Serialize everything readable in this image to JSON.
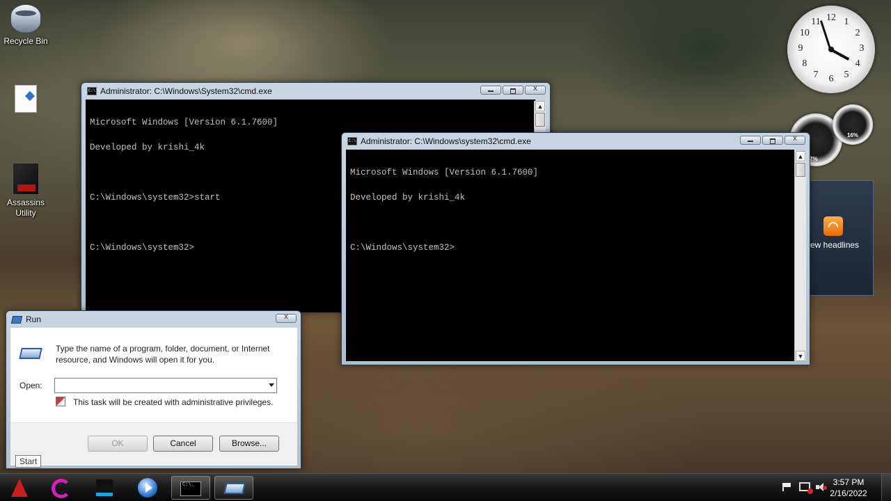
{
  "desktop": {
    "icons": [
      {
        "label": "Recycle Bin"
      },
      {
        "label": ""
      },
      {
        "label_line1": "Assassins",
        "label_line2": "Utility"
      }
    ]
  },
  "gadgets": {
    "clock": {
      "hour": 3,
      "minute": 57,
      "numerals": [
        "12",
        "1",
        "2",
        "3",
        "4",
        "5",
        "6",
        "7",
        "8",
        "9",
        "10",
        "11"
      ]
    },
    "cpu_meter": {
      "cpu_label": "7%",
      "memory_label": "16%"
    },
    "feed": {
      "headline_text": "ew headlines"
    }
  },
  "cmd_back": {
    "title": "Administrator: C:\\Windows\\System32\\cmd.exe",
    "lines": [
      "Microsoft Windows [Version 6.1.7600]",
      "Developed by krishi_4k",
      "",
      "C:\\Windows\\system32>start",
      "",
      "C:\\Windows\\system32>"
    ]
  },
  "cmd_front": {
    "title": "Administrator: C:\\Windows\\system32\\cmd.exe",
    "lines": [
      "Microsoft Windows [Version 6.1.7600]",
      "Developed by krishi_4k",
      "",
      "C:\\Windows\\system32>"
    ]
  },
  "run": {
    "title": "Run",
    "description_line1": "Type the name of a program, folder, document, or Internet",
    "description_line2": "resource, and Windows will open it for you.",
    "open_label": "Open:",
    "open_value": "",
    "admin_note": "This task will be created with administrative privileges.",
    "ok_label": "OK",
    "cancel_label": "Cancel",
    "browse_label": "Browse..."
  },
  "tooltip": {
    "text": "Start"
  },
  "taskbar": {
    "items": [
      "start-orb",
      "internet-explorer",
      "app-launcher",
      "media-player",
      "command-prompt",
      "run-dialog"
    ],
    "clock_time": "3:57 PM",
    "clock_date": "2/16/2022"
  },
  "colors": {
    "console_bg": "#000000",
    "console_fg": "#c0c0c0",
    "window_frame": "#b0bfcf",
    "taskbar": "#111111"
  }
}
